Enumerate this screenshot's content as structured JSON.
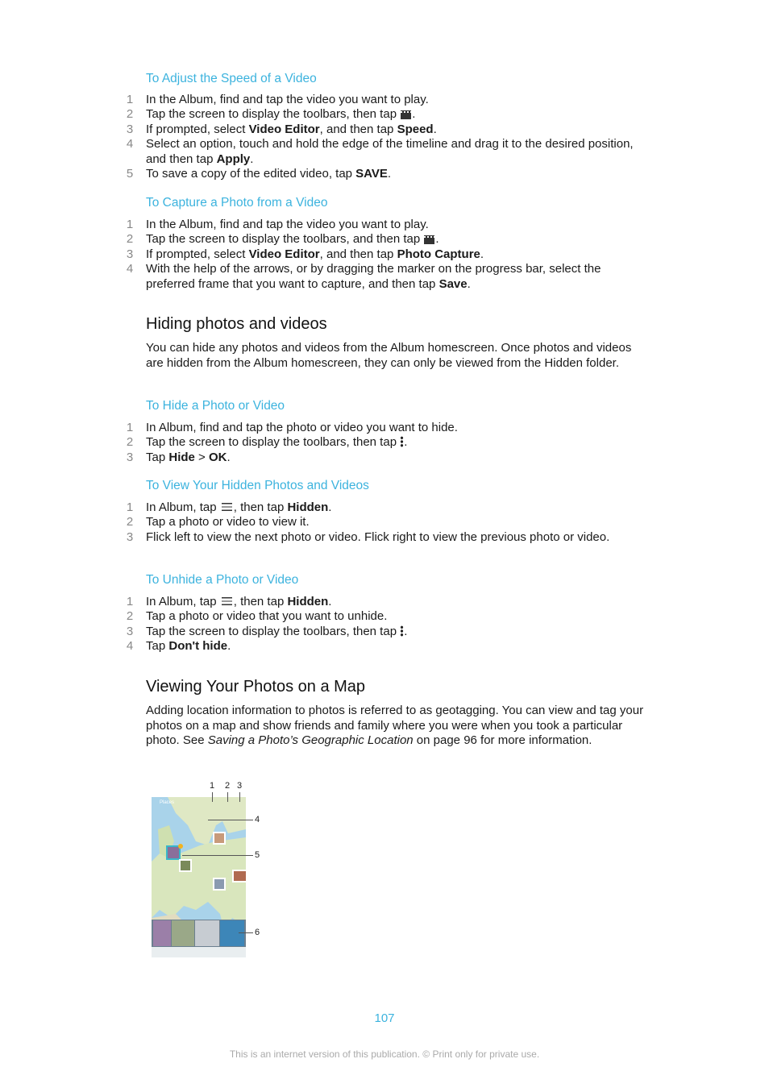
{
  "blocks": [
    {
      "type": "sub",
      "text": "To Adjust the Speed of a Video"
    },
    {
      "type": "steps",
      "items": [
        [
          {
            "t": "In the Album, find and tap the video you want to play."
          }
        ],
        [
          {
            "t": "Tap the screen to display the toolbars, then tap "
          },
          {
            "icon": "clapperboard"
          },
          {
            "t": "."
          }
        ],
        [
          {
            "t": "If prompted, select "
          },
          {
            "t": "Video Editor",
            "b": true
          },
          {
            "t": ", and then tap "
          },
          {
            "t": "Speed",
            "b": true
          },
          {
            "t": "."
          }
        ],
        [
          {
            "t": "Select an option, touch and hold the edge of the timeline and drag it to the desired position, and then tap "
          },
          {
            "t": "Apply",
            "b": true
          },
          {
            "t": "."
          }
        ],
        [
          {
            "t": "To save a copy of the edited video, tap "
          },
          {
            "t": "SAVE",
            "b": true
          },
          {
            "t": "."
          }
        ]
      ]
    },
    {
      "type": "sub",
      "text": "To Capture a Photo from a Video"
    },
    {
      "type": "steps",
      "items": [
        [
          {
            "t": "In the Album, find and tap the video you want to play."
          }
        ],
        [
          {
            "t": "Tap the screen to display the toolbars, and then tap "
          },
          {
            "icon": "clapperboard"
          },
          {
            "t": "."
          }
        ],
        [
          {
            "t": "If prompted, select "
          },
          {
            "t": "Video Editor",
            "b": true
          },
          {
            "t": ", and then tap "
          },
          {
            "t": "Photo Capture",
            "b": true
          },
          {
            "t": "."
          }
        ],
        [
          {
            "t": "With the help of the arrows, or by dragging the marker on the progress bar, select the preferred frame that you want to capture, and then tap "
          },
          {
            "t": "Save",
            "b": true
          },
          {
            "t": "."
          }
        ]
      ]
    },
    {
      "type": "sec",
      "text": "Hiding photos and videos"
    },
    {
      "type": "para",
      "segs": [
        {
          "t": "You can hide any photos and videos from the Album homescreen. Once photos and videos are hidden from the Album homescreen, they can only be viewed from the Hidden folder."
        }
      ]
    },
    {
      "type": "sub",
      "text": "To Hide a Photo or Video"
    },
    {
      "type": "steps",
      "items": [
        [
          {
            "t": "In Album, find and tap the photo or video you want to hide."
          }
        ],
        [
          {
            "t": "Tap the screen to display the toolbars, then tap "
          },
          {
            "icon": "more-vertical"
          },
          {
            "t": "."
          }
        ],
        [
          {
            "t": "Tap "
          },
          {
            "t": "Hide",
            "b": true
          },
          {
            "t": " > "
          },
          {
            "t": "OK",
            "b": true
          },
          {
            "t": "."
          }
        ]
      ]
    },
    {
      "type": "sub",
      "text": "To View Your Hidden Photos and Videos"
    },
    {
      "type": "steps",
      "items": [
        [
          {
            "t": "In Album, tap "
          },
          {
            "icon": "menu"
          },
          {
            "t": ", then tap "
          },
          {
            "t": "Hidden",
            "b": true
          },
          {
            "t": "."
          }
        ],
        [
          {
            "t": "Tap a photo or video to view it."
          }
        ],
        [
          {
            "t": "Flick left to view the next photo or video. Flick right to view the previous photo or video."
          }
        ]
      ]
    },
    {
      "type": "sub",
      "text": "To Unhide a Photo or Video"
    },
    {
      "type": "steps",
      "items": [
        [
          {
            "t": "In Album, tap "
          },
          {
            "icon": "menu"
          },
          {
            "t": ", then tap "
          },
          {
            "t": "Hidden",
            "b": true
          },
          {
            "t": "."
          }
        ],
        [
          {
            "t": "Tap a photo or video that you want to unhide."
          }
        ],
        [
          {
            "t": "Tap the screen to display the toolbars, then tap "
          },
          {
            "icon": "more-vertical"
          },
          {
            "t": "."
          }
        ],
        [
          {
            "t": "Tap "
          },
          {
            "t": "Don't hide",
            "b": true
          },
          {
            "t": "."
          }
        ]
      ]
    },
    {
      "type": "sec",
      "text": "Viewing Your Photos on a Map"
    },
    {
      "type": "para",
      "segs": [
        {
          "t": "Adding location information to photos is referred to as geotagging. You can view and tag your photos on a map and show friends and family where you were when you took a particular photo. See "
        },
        {
          "t": "Saving a Photo’s Geographic Location",
          "i": true
        },
        {
          "t": " on page 96 for more information."
        }
      ]
    }
  ],
  "figure": {
    "callouts": [
      "1",
      "2",
      "3",
      "4",
      "5",
      "6"
    ],
    "screen_title": "Places",
    "badge": "8"
  },
  "page_number": "107",
  "footer": "This is an internet version of this publication. © Print only for private use.",
  "colors": {
    "accent": "#3cb3de",
    "text": "#1a1a1a",
    "step_number": "#888888"
  }
}
